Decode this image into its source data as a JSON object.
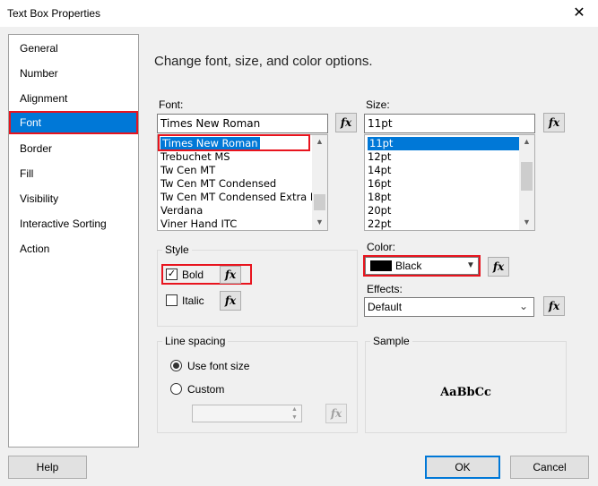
{
  "window": {
    "title": "Text Box Properties",
    "close_glyph": "✕"
  },
  "nav": {
    "items": [
      {
        "label": "General"
      },
      {
        "label": "Number"
      },
      {
        "label": "Alignment"
      },
      {
        "label": "Font",
        "selected": true
      },
      {
        "label": "Border"
      },
      {
        "label": "Fill"
      },
      {
        "label": "Visibility"
      },
      {
        "label": "Interactive Sorting"
      },
      {
        "label": "Action"
      }
    ]
  },
  "main": {
    "heading": "Change font, size, and color options.",
    "font": {
      "label": "Font:",
      "value": "Times New Roman",
      "list": [
        "Times New Roman",
        "Trebuchet MS",
        "Tw Cen MT",
        "Tw Cen MT Condensed",
        "Tw Cen MT Condensed Extra Bo",
        "Verdana",
        "Viner Hand ITC"
      ],
      "selected_index": 0
    },
    "size": {
      "label": "Size:",
      "value": "11pt",
      "list": [
        "11pt",
        "12pt",
        "14pt",
        "16pt",
        "18pt",
        "20pt",
        "22pt"
      ],
      "selected_index": 0
    },
    "fx_label": "fx",
    "style": {
      "title": "Style",
      "bold": {
        "label": "Bold",
        "checked": true,
        "mark": "✓"
      },
      "italic": {
        "label": "Italic",
        "checked": false
      }
    },
    "color": {
      "label": "Color:",
      "value": "Black",
      "swatch": "#000000"
    },
    "effects": {
      "label": "Effects:",
      "value": "Default"
    },
    "line_spacing": {
      "title": "Line spacing",
      "use_font_size": {
        "label": "Use font size",
        "checked": true
      },
      "custom": {
        "label": "Custom",
        "checked": false
      },
      "custom_value": ""
    },
    "sample": {
      "title": "Sample",
      "text": "AaBbCc"
    }
  },
  "buttons": {
    "help": "Help",
    "ok": "OK",
    "cancel": "Cancel"
  },
  "colors": {
    "accent": "#0078d7",
    "highlight_border": "#e8141e"
  }
}
